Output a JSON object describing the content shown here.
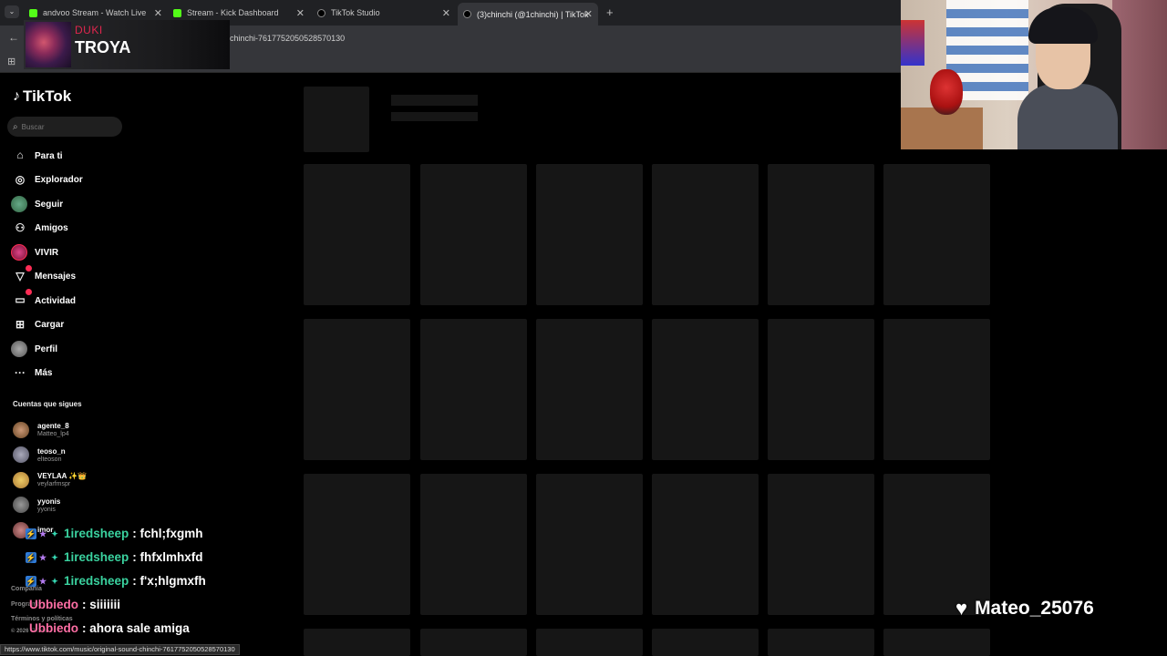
{
  "browser": {
    "tabs": [
      {
        "label": "andvoo Stream - Watch Live",
        "favicon": "kick-icon",
        "active": false
      },
      {
        "label": "Stream - Kick Dashboard",
        "favicon": "kick-icon",
        "active": false
      },
      {
        "label": "TikTok Studio",
        "favicon": "tiktok-icon",
        "active": false
      },
      {
        "label": "(3)chinchi (@1chinchi) | TikTok",
        "favicon": "tiktok-icon",
        "active": true
      }
    ],
    "new_tab": "+",
    "close_glyph": "✕",
    "url": "chinchi-7617752050528570130",
    "status_url": "https://www.tiktok.com/music/original-sound-chinchi-7617752050528570130"
  },
  "now_playing": {
    "artist": "DUKI",
    "title": "TROYA"
  },
  "tiktok": {
    "logo": "TikTok",
    "search_placeholder": "Buscar",
    "menu": [
      {
        "label": "Para ti",
        "icon": "home-icon"
      },
      {
        "label": "Explorador",
        "icon": "compass-icon"
      },
      {
        "label": "Seguir",
        "icon": "following-avatar-icon"
      },
      {
        "label": "Amigos",
        "icon": "friends-icon"
      },
      {
        "label": "VIVIR",
        "icon": "live-icon"
      },
      {
        "label": "Mensajes",
        "icon": "messages-icon"
      },
      {
        "label": "Actividad",
        "icon": "activity-icon"
      },
      {
        "label": "Cargar",
        "icon": "upload-icon"
      },
      {
        "label": "Perfil",
        "icon": "profile-avatar-icon"
      },
      {
        "label": "Más",
        "icon": "more-icon"
      }
    ],
    "following_header": "Cuentas que sigues",
    "following": [
      {
        "name": "agente_8",
        "handle": "Matteo_lp4"
      },
      {
        "name": "teoso_n",
        "handle": "elteoson"
      },
      {
        "name": "VEYLAA ✨👑",
        "handle": "veylarfmspr"
      },
      {
        "name": "yyonis",
        "handle": "yyonis"
      },
      {
        "name": "imor",
        "handle": ""
      }
    ],
    "footer": [
      "Compañía",
      "Programa",
      "Términos y políticas",
      "© 2026 TikTok"
    ]
  },
  "chat": [
    {
      "user": "1iredsheep",
      "text": ": fchl;fxgmh",
      "color": "#3ad29f",
      "badges": true
    },
    {
      "user": "1iredsheep",
      "text": ": fhfxlmhxfd",
      "color": "#3ad29f",
      "badges": true
    },
    {
      "user": "1iredsheep",
      "text": ": f'x;hlgmxfh",
      "color": "#3ad29f",
      "badges": true
    },
    {
      "user": "Ubbiedo",
      "text": ": siiiiiii",
      "color": "#ff6fa5",
      "badges": false
    },
    {
      "user": "Ubbiedo",
      "text": ": ahora sale amiga",
      "color": "#ff6fa5",
      "badges": false
    }
  ],
  "alert": {
    "icon": "heart-icon",
    "name": "Mateo_25076"
  }
}
